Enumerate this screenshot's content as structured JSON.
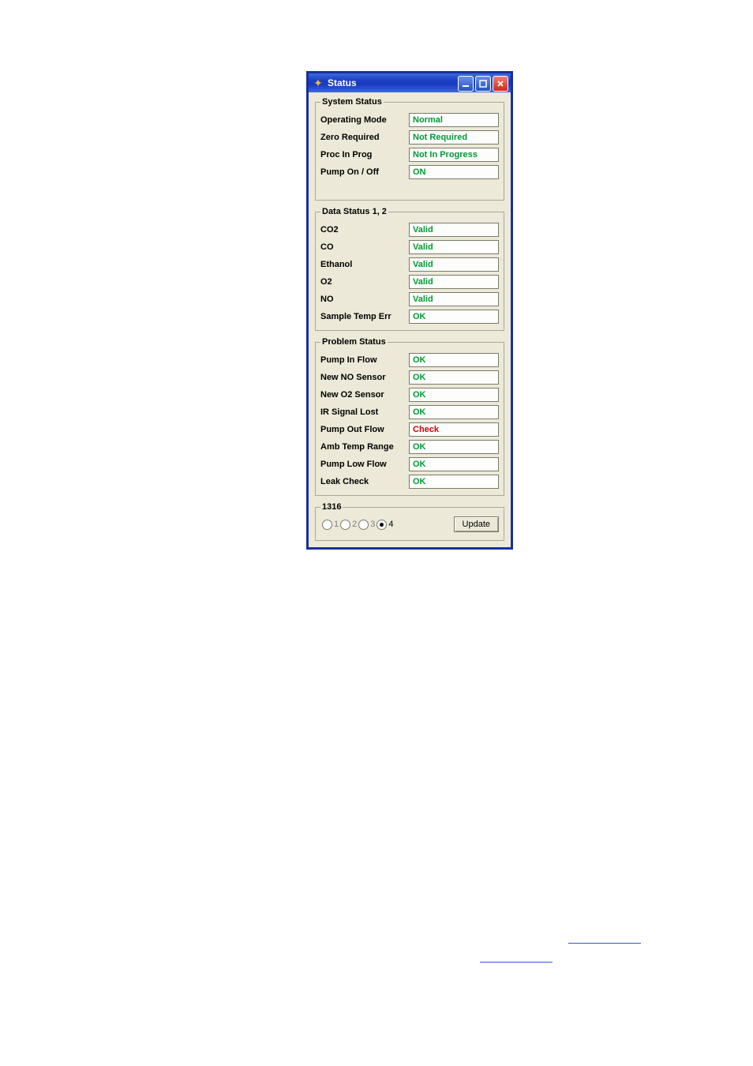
{
  "window": {
    "title": "Status",
    "icon": "app-plus-icon"
  },
  "groups": {
    "system": {
      "legend": "System Status",
      "rows": [
        {
          "label": "Operating Mode",
          "value": "Normal",
          "cls": "val-green"
        },
        {
          "label": "Zero Required",
          "value": "Not Required",
          "cls": "val-green"
        },
        {
          "label": "Proc In Prog",
          "value": "Not In Progress",
          "cls": "val-green"
        },
        {
          "label": "Pump On / Off",
          "value": "ON",
          "cls": "val-green"
        }
      ]
    },
    "data": {
      "legend": "Data Status 1, 2",
      "rows": [
        {
          "label": "CO2",
          "value": "Valid",
          "cls": "val-green"
        },
        {
          "label": "CO",
          "value": "Valid",
          "cls": "val-green"
        },
        {
          "label": "Ethanol",
          "value": "Valid",
          "cls": "val-green"
        },
        {
          "label": "O2",
          "value": "Valid",
          "cls": "val-green"
        },
        {
          "label": "NO",
          "value": "Valid",
          "cls": "val-green"
        },
        {
          "label": "Sample Temp Err",
          "value": "OK",
          "cls": "val-green"
        }
      ]
    },
    "problem": {
      "legend": "Problem Status",
      "rows": [
        {
          "label": "Pump In Flow",
          "value": "OK",
          "cls": "val-green"
        },
        {
          "label": "New NO Sensor",
          "value": "OK",
          "cls": "val-green"
        },
        {
          "label": "New O2 Sensor",
          "value": "OK",
          "cls": "val-green"
        },
        {
          "label": "IR Signal Lost",
          "value": "OK",
          "cls": "val-green"
        },
        {
          "label": "Pump Out Flow",
          "value": "Check",
          "cls": "val-red"
        },
        {
          "label": "Amb Temp Range",
          "value": "OK",
          "cls": "val-green"
        },
        {
          "label": "Pump Low Flow",
          "value": "OK",
          "cls": "val-green"
        },
        {
          "label": "Leak Check",
          "value": "OK",
          "cls": "val-green"
        }
      ]
    },
    "footer": {
      "legend": "1316",
      "options": [
        {
          "label": "1",
          "selected": false
        },
        {
          "label": "2",
          "selected": false
        },
        {
          "label": "3",
          "selected": false
        },
        {
          "label": "4",
          "selected": true
        }
      ],
      "button": "Update"
    }
  }
}
